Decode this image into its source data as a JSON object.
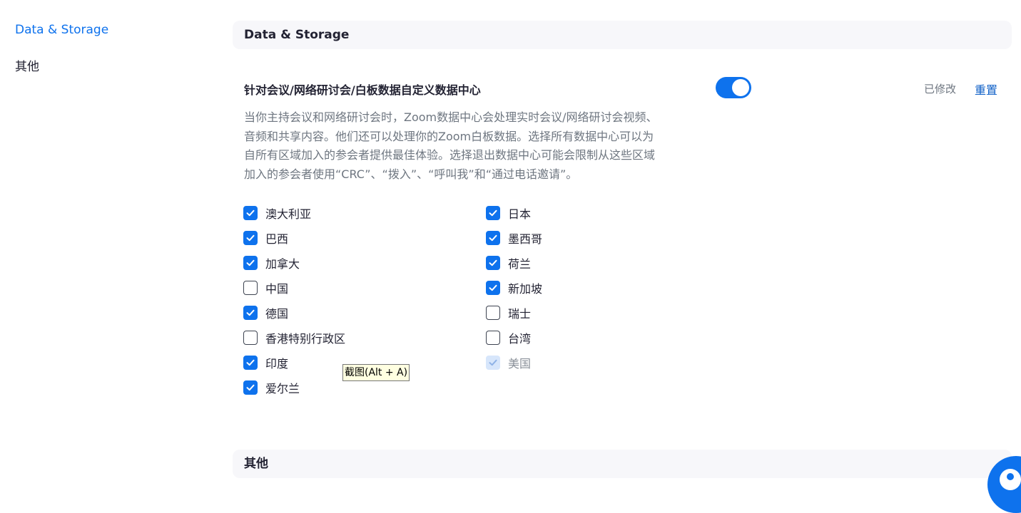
{
  "sidebar": {
    "items": [
      {
        "label": "Data & Storage",
        "active": true
      },
      {
        "label": "其他",
        "active": false
      }
    ]
  },
  "section": {
    "header": "Data & Storage",
    "setting_title": "针对会议/网络研讨会/白板数据自定义数据中心",
    "toggle_on": true,
    "modified_label": "已修改",
    "reset_label": "重置",
    "description_lines": [
      "当你主持会议和网络研讨会时，Zoom数据中心会处理实时会议/网络研讨会视频、",
      "音频和共享内容。他们还可以处理你的Zoom白板数据。选择所有数据中心可以为",
      "自所有区域加入的参会者提供最佳体验。选择退出数据中心可能会限制从这些区域",
      "加入的参会者使用“CRC”、“拨入”、“呼叫我”和“通过电话邀请”。"
    ],
    "regions_left": [
      {
        "label": "澳大利亚",
        "checked": true
      },
      {
        "label": "巴西",
        "checked": true
      },
      {
        "label": "加拿大",
        "checked": true
      },
      {
        "label": "中国",
        "checked": false
      },
      {
        "label": "德国",
        "checked": true
      },
      {
        "label": "香港特别行政区",
        "checked": false
      },
      {
        "label": "印度",
        "checked": true
      },
      {
        "label": "爱尔兰",
        "checked": true
      }
    ],
    "regions_right": [
      {
        "label": "日本",
        "checked": true
      },
      {
        "label": "墨西哥",
        "checked": true
      },
      {
        "label": "荷兰",
        "checked": true
      },
      {
        "label": "新加坡",
        "checked": true
      },
      {
        "label": "瑞士",
        "checked": false
      },
      {
        "label": "台湾",
        "checked": false
      },
      {
        "label": "美国",
        "checked": true,
        "disabled": true
      }
    ]
  },
  "section2": {
    "header": "其他"
  },
  "tooltip": {
    "text": "截图(Alt + A)"
  },
  "colors": {
    "accent": "#0e72ed",
    "header_bg": "#f7f7fa",
    "muted_text": "#6e7680"
  },
  "icons": {
    "check": "checkmark-icon",
    "fab": "help-person-icon"
  }
}
